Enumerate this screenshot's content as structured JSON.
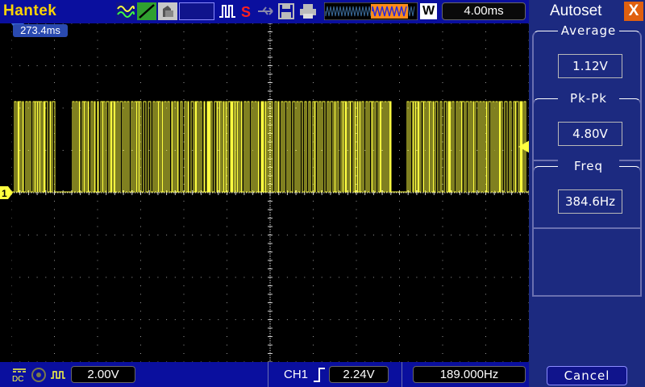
{
  "header": {
    "brand": "Hantek",
    "timebase": "4.00ms",
    "acq_mode": "W",
    "icons": [
      "waveform-icon",
      "math-icon",
      "ref-icon",
      "trigger-type-icon",
      "single-mode-icon",
      "usb-icon",
      "save-icon",
      "print-icon",
      "waveform-memory-icon"
    ]
  },
  "screen": {
    "trigger_position": "273.4ms",
    "channel_marker": "1",
    "colors": {
      "trace": "#ffff40",
      "grid": "#9a9a9a",
      "bars": "#0a0f9e",
      "panel": "#1c2a80"
    }
  },
  "footer": {
    "coupling": "DC",
    "ch1_scale": "2.00V",
    "trigger_source": "CH1",
    "trigger_slope": "rising",
    "trigger_level": "2.24V",
    "frequency": "189.000Hz"
  },
  "panel": {
    "title": "Autoset",
    "close_label": "X",
    "groups": [
      {
        "label": "Average",
        "value": "1.12V"
      },
      {
        "label": "Pk-Pk",
        "value": "4.80V"
      },
      {
        "label": "Freq",
        "value": "384.6Hz"
      }
    ],
    "cancel_label": "Cancel"
  }
}
